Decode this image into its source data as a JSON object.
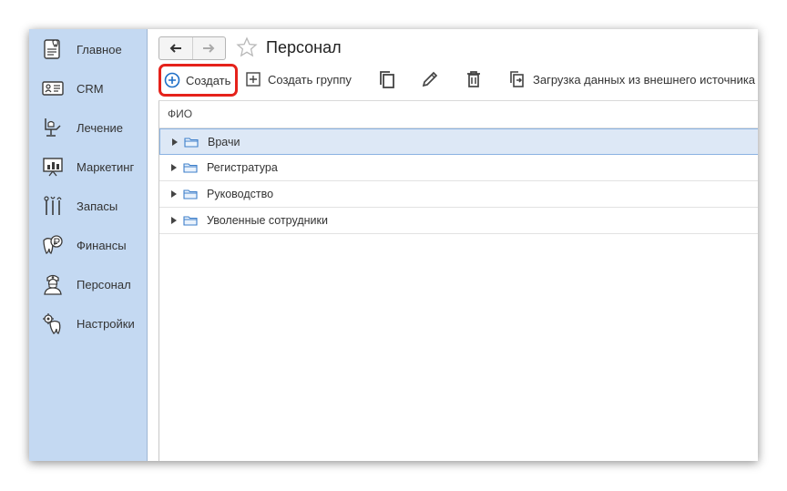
{
  "sidebar": {
    "items": [
      {
        "label": "Главное",
        "icon": "main-icon"
      },
      {
        "label": "CRM",
        "icon": "crm-icon"
      },
      {
        "label": "Лечение",
        "icon": "dental-chair-icon"
      },
      {
        "label": "Маркетинг",
        "icon": "presentation-icon"
      },
      {
        "label": "Запасы",
        "icon": "dental-tools-icon"
      },
      {
        "label": "Финансы",
        "icon": "tooth-ruble-icon"
      },
      {
        "label": "Персонал",
        "icon": "doctor-icon"
      },
      {
        "label": "Настройки",
        "icon": "tooth-gear-icon"
      }
    ]
  },
  "header": {
    "title": "Персонал",
    "favorite": false
  },
  "toolbar": {
    "create_label": "Создать",
    "create_group_label": "Создать группу",
    "upload_label": "Загрузка данных из внешнего источника",
    "icons": [
      "copy-icon",
      "edit-icon",
      "delete-icon",
      "upload-icon"
    ]
  },
  "grid": {
    "column_header": "ФИО",
    "rows": [
      {
        "label": "Врачи",
        "selected": true
      },
      {
        "label": "Регистратура",
        "selected": false
      },
      {
        "label": "Руководство",
        "selected": false
      },
      {
        "label": "Уволенные сотрудники",
        "selected": false
      }
    ]
  },
  "colors": {
    "sidebar_bg": "#c4d9f2",
    "highlight_red": "#e5221b",
    "accent_blue": "#1e6fc7",
    "selected_row": "#dde8f6"
  }
}
